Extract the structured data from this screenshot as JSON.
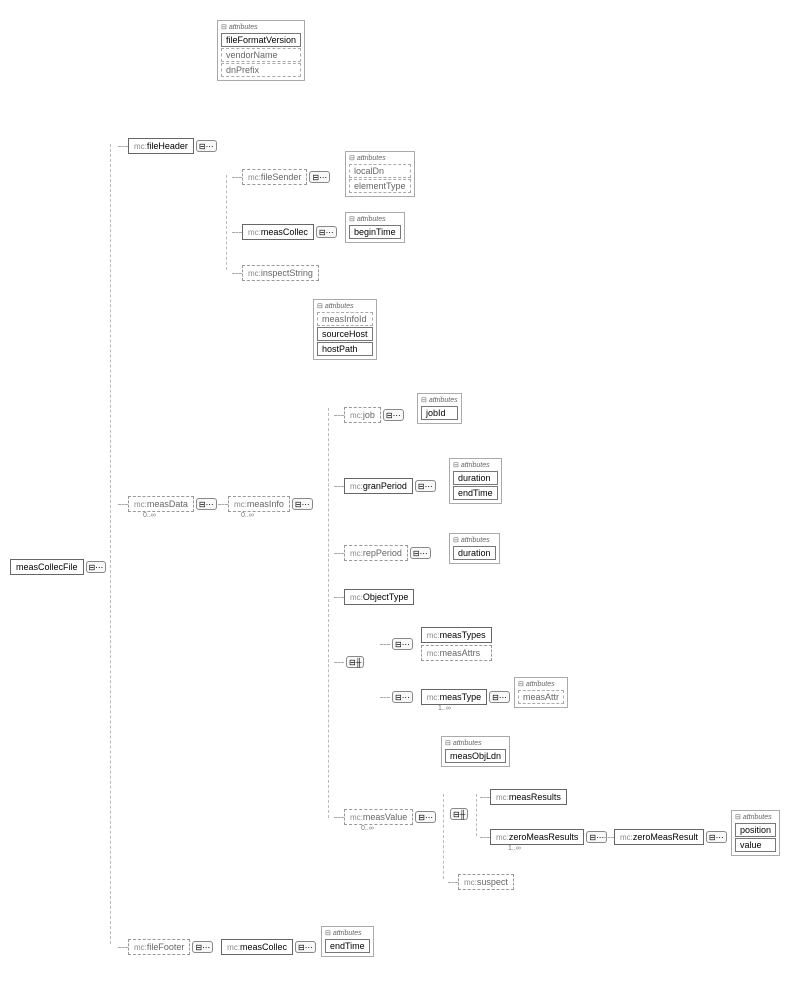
{
  "root": "measCollecFile",
  "nodes": {
    "fileHeader": "fileHeader",
    "fileSender": "fileSender",
    "measCollec1": "measCollec",
    "inspectString": "inspectString",
    "measData": "measData",
    "measInfo": "measInfo",
    "job": "job",
    "granPeriod": "granPeriod",
    "repPeriod": "repPeriod",
    "ObjectType": "ObjectType",
    "measTypes": "measTypes",
    "measAttrs": "measAttrs",
    "measType": "measType",
    "measValue": "measValue",
    "measResults": "measResults",
    "zeroMeasResults": "zeroMeasResults",
    "zeroMeasResult": "zeroMeasResult",
    "suspect": "suspect",
    "fileFooter": "fileFooter",
    "measCollec2": "measCollec"
  },
  "prefix": "mc:",
  "attrLabel": "attributes",
  "attrs": {
    "fileHeader": [
      "fileFormatVersion",
      "vendorName",
      "dnPrefix"
    ],
    "fileSender": [
      "localDn",
      "elementType"
    ],
    "measCollec1": [
      "beginTime"
    ],
    "measInfo": [
      "measInfoId",
      "sourceHost",
      "hostPath"
    ],
    "job": [
      "jobId"
    ],
    "granPeriod": [
      "duration",
      "endTime"
    ],
    "repPeriod": [
      "duration"
    ],
    "measType": [
      "measAttr"
    ],
    "measValue": [
      "measObjLdn"
    ],
    "zeroMeasResult": [
      "position",
      "value"
    ],
    "measCollec2": [
      "endTime"
    ]
  },
  "attrsDashed": {
    "fileHeader": [
      false,
      true,
      true
    ],
    "measInfo": [
      true,
      false,
      false
    ]
  },
  "occ": {
    "measData": "0..∞",
    "measInfo": "0..∞",
    "measType": "1..∞",
    "measValue": "0..∞",
    "zeroMeasResults": "1..∞"
  }
}
